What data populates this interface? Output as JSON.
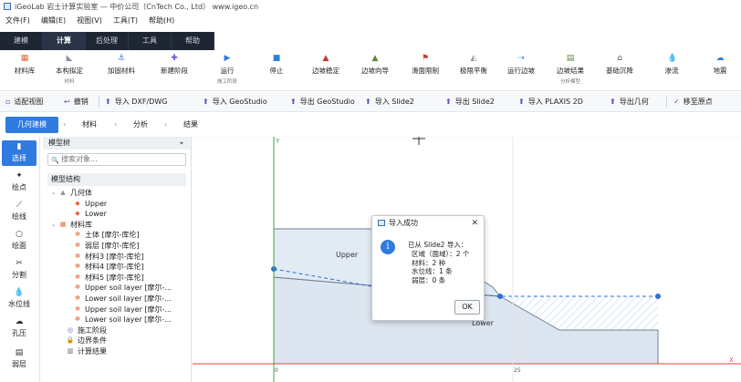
{
  "window": {
    "title": "iGeoLab 岩土计算实验室 — 中价公司（CnTech Co., Ltd）  www.igeo.cn"
  },
  "menu": [
    "文件(F)",
    "编辑(E)",
    "视图(V)",
    "工具(T)",
    "帮助(H)"
  ],
  "top_tabs": [
    {
      "label": "建模",
      "active": false
    },
    {
      "label": "计算",
      "active": true
    },
    {
      "label": "后处理",
      "active": false
    },
    {
      "label": "工具",
      "active": false
    },
    {
      "label": "帮助",
      "active": false
    }
  ],
  "ribbon": [
    {
      "label": "材料库",
      "icon": "material-library-icon",
      "glyph": "▦",
      "color": "#e2683a",
      "sub": ""
    },
    {
      "label": "本构拟定",
      "icon": "constitutive-icon",
      "glyph": "◣",
      "color": "#8a94a3",
      "sub": "材料"
    },
    {
      "label": "加固材料",
      "icon": "anchor-icon",
      "glyph": "⚓",
      "color": "#2f7be0",
      "sub": ""
    },
    {
      "label": "新建阶段",
      "icon": "add-stage-icon",
      "glyph": "✚",
      "color": "#6b55c7",
      "sub": ""
    },
    {
      "label": "运行",
      "icon": "run-icon",
      "glyph": "▶",
      "color": "#2f7be0",
      "sub": "施工阶段"
    },
    {
      "label": "停止",
      "icon": "stop-icon",
      "glyph": "■",
      "color": "#2f7be0",
      "sub": ""
    },
    {
      "label": "边坡稳定",
      "icon": "slope-stability-icon",
      "glyph": "▲",
      "color": "#c0392b",
      "sub": ""
    },
    {
      "label": "边坡向导",
      "icon": "slope-wizard-icon",
      "glyph": "▲",
      "color": "#5a8a3a",
      "sub": ""
    },
    {
      "label": "滑面限制",
      "icon": "slip-limit-icon",
      "glyph": "⚑",
      "color": "#c0392b",
      "sub": ""
    },
    {
      "label": "极限平衡",
      "icon": "limit-equilibrium-icon",
      "glyph": "◭",
      "color": "#8a94a3",
      "sub": ""
    },
    {
      "label": "运行边坡",
      "icon": "run-slope-icon",
      "glyph": "⇢",
      "color": "#2f7be0",
      "sub": ""
    },
    {
      "label": "边坡结果",
      "icon": "slope-results-icon",
      "glyph": "▤",
      "color": "#5a8a3a",
      "sub": "分析模型"
    },
    {
      "label": "基础沉降",
      "icon": "settlement-icon",
      "glyph": "⌂",
      "color": "#555",
      "sub": ""
    },
    {
      "label": "渗流",
      "icon": "seepage-icon",
      "glyph": "💧",
      "color": "#2f7be0",
      "sub": ""
    },
    {
      "label": "地震",
      "icon": "earthquake-icon",
      "glyph": "☁",
      "color": "#2f7be0",
      "sub": ""
    }
  ],
  "quickbar": [
    "适配视图",
    "撤销",
    "导入 DXF/DWG",
    "导入 GeoStudio",
    "导出 GeoStudio",
    "导入 Slide2",
    "导出 Slide2",
    "导入 PLAXIS 2D",
    "导出几何",
    "移至原点"
  ],
  "steps": [
    {
      "label": "几何建模",
      "active": true
    },
    {
      "label": "材料",
      "active": false
    },
    {
      "label": "分析",
      "active": false
    },
    {
      "label": "结果",
      "active": false
    }
  ],
  "left_tools": [
    {
      "label": "选择",
      "glyph": "▮",
      "active": true
    },
    {
      "label": "绘点",
      "glyph": "✦",
      "active": false
    },
    {
      "label": "绘线",
      "glyph": "⟋",
      "active": false
    },
    {
      "label": "绘面",
      "glyph": "○",
      "active": false
    },
    {
      "label": "分割",
      "glyph": "✂",
      "active": false
    },
    {
      "label": "水位线",
      "glyph": "💧",
      "active": false
    },
    {
      "label": "孔压",
      "glyph": "☁",
      "active": false
    },
    {
      "label": "弱层",
      "glyph": "▤",
      "active": false
    }
  ],
  "tree_panel": {
    "header": "模型树",
    "search_placeholder": "搜索对象...",
    "section": "模型结构",
    "nodes": [
      {
        "label": "几何体",
        "indent": 0,
        "arrow": "⌄",
        "icon": "▲",
        "color": "#8a94a3"
      },
      {
        "label": "Upper",
        "indent": 2,
        "arrow": "",
        "icon": "◆",
        "color": "#e2683a"
      },
      {
        "label": "Lower",
        "indent": 2,
        "arrow": "",
        "icon": "◆",
        "color": "#e2683a"
      },
      {
        "label": "材料库",
        "indent": 0,
        "arrow": "⌄",
        "icon": "▦",
        "color": "#e2683a"
      },
      {
        "label": "土体 [摩尔-库伦]",
        "indent": 2,
        "arrow": "",
        "icon": "✻",
        "color": "#e2683a"
      },
      {
        "label": "弱层 [摩尔-库伦]",
        "indent": 2,
        "arrow": "",
        "icon": "✻",
        "color": "#e2683a"
      },
      {
        "label": "材料3 [摩尔-库伦]",
        "indent": 2,
        "arrow": "",
        "icon": "✻",
        "color": "#e2683a"
      },
      {
        "label": "材料4 [摩尔-库伦]",
        "indent": 2,
        "arrow": "",
        "icon": "✻",
        "color": "#e2683a"
      },
      {
        "label": "材料5 [摩尔-库伦]",
        "indent": 2,
        "arrow": "",
        "icon": "✻",
        "color": "#e2683a"
      },
      {
        "label": "Upper soil layer [摩尔-...",
        "indent": 2,
        "arrow": "",
        "icon": "✻",
        "color": "#e2683a"
      },
      {
        "label": "Lower soil layer [摩尔-...",
        "indent": 2,
        "arrow": "",
        "icon": "✻",
        "color": "#e2683a"
      },
      {
        "label": "Upper soil layer [摩尔-...",
        "indent": 2,
        "arrow": "",
        "icon": "✻",
        "color": "#e2683a"
      },
      {
        "label": "Lower soil layer [摩尔-...",
        "indent": 2,
        "arrow": "",
        "icon": "✻",
        "color": "#e2683a"
      },
      {
        "label": "施工阶段",
        "indent": 1,
        "arrow": "",
        "icon": "◎",
        "color": "#6b55c7"
      },
      {
        "label": "边界条件",
        "indent": 1,
        "arrow": "",
        "icon": "🔒",
        "color": "#d89a2a"
      },
      {
        "label": "计算结果",
        "indent": 1,
        "arrow": "",
        "icon": "▥",
        "color": "#5a6677"
      }
    ]
  },
  "canvas": {
    "y_axis_label": "Y",
    "x_axis_label": "X",
    "x_tick_0": "0",
    "x_tick_25": "25",
    "region_upper": "Upper",
    "region_lower": "Lower"
  },
  "dialog": {
    "title": "导入成功",
    "lines": [
      "已从 Slide2 导入：",
      "区域（面域）：2 个",
      "材料：2 种",
      "水位线：1 条",
      "弱层：0 条"
    ],
    "ok": "OK"
  },
  "colors": {
    "accent": "#2f7be0",
    "dark_tab": "#1e2633",
    "geometry_fill": "#dde6f0",
    "axis_red": "#d9463a",
    "axis_green": "#3aa640"
  }
}
